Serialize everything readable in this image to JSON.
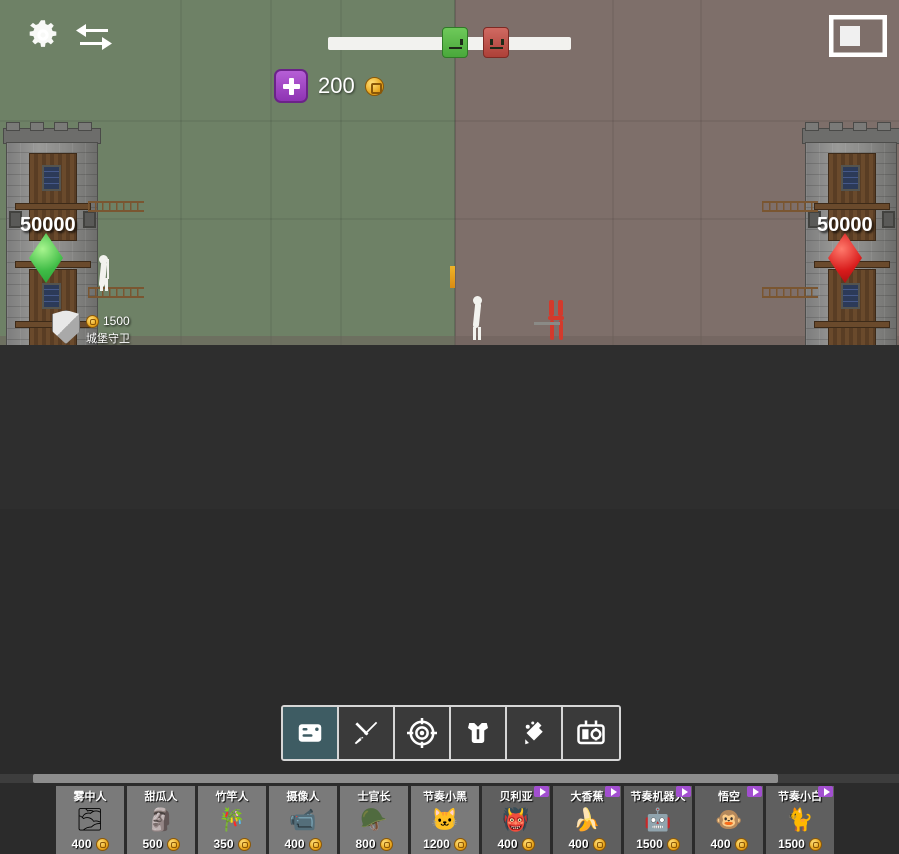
{
  "hud": {
    "settings_icon": "gear-icon",
    "swap_icon": "swap-arrows-icon",
    "layout_icon": "layout-panel-icon",
    "money_value": "200",
    "money_icon": "coin-icon",
    "add_money_label": "+"
  },
  "wave_bar": {
    "ally_marker": "green-face-token",
    "enemy_marker": "red-face-token",
    "ally_position_pct": 47,
    "enemy_position_pct": 64
  },
  "castles": {
    "left": {
      "hp": "50000",
      "gem_icon": "green-diamond-icon"
    },
    "right": {
      "hp": "50000",
      "gem_icon": "red-diamond-icon"
    }
  },
  "guard": {
    "icon": "shield-icon",
    "cost": "1500",
    "name": "城堡守卫"
  },
  "toolbar": {
    "items": [
      {
        "name": "tab-cards",
        "icon": "cards-icon",
        "active": true
      },
      {
        "name": "tab-melee",
        "icon": "sword-icon",
        "active": false
      },
      {
        "name": "tab-target",
        "icon": "target-icon",
        "active": false
      },
      {
        "name": "tab-armor",
        "icon": "armor-icon",
        "active": false
      },
      {
        "name": "tab-weapon",
        "icon": "grenade-icon",
        "active": false
      },
      {
        "name": "tab-machine",
        "icon": "machine-icon",
        "active": false
      }
    ]
  },
  "cards": [
    {
      "name": "雾中人",
      "cost": "400",
      "locked": false,
      "video": false,
      "art": "🌫"
    },
    {
      "name": "甜瓜人",
      "cost": "500",
      "locked": false,
      "video": false,
      "art": "🗿"
    },
    {
      "name": "竹竿人",
      "cost": "350",
      "locked": false,
      "video": false,
      "art": "🎋"
    },
    {
      "name": "摄像人",
      "cost": "400",
      "locked": false,
      "video": false,
      "art": "📹"
    },
    {
      "name": "士官长",
      "cost": "800",
      "locked": false,
      "video": false,
      "art": "🪖"
    },
    {
      "name": "节奏小黑",
      "cost": "1200",
      "locked": false,
      "video": false,
      "art": "🐱"
    },
    {
      "name": "贝利亚",
      "cost": "400",
      "locked": true,
      "video": true,
      "art": "👹"
    },
    {
      "name": "大香蕉",
      "cost": "400",
      "locked": true,
      "video": true,
      "art": "🍌"
    },
    {
      "name": "节奏机器人",
      "cost": "1500",
      "locked": true,
      "video": true,
      "art": "🤖"
    },
    {
      "name": "悟空",
      "cost": "400",
      "locked": true,
      "video": true,
      "art": "🐵"
    },
    {
      "name": "节奏小白",
      "cost": "1500",
      "locked": true,
      "video": true,
      "art": "🐈"
    }
  ],
  "colors": {
    "ally_territory": "#6e8166",
    "enemy_territory": "#7e6f6a",
    "accent_active": "#3e5c63",
    "money_purple": "#a24fd0",
    "coin_gold": "#e8a51c",
    "ally_gem": "#3fbc46",
    "enemy_gem": "#d81b1b"
  }
}
